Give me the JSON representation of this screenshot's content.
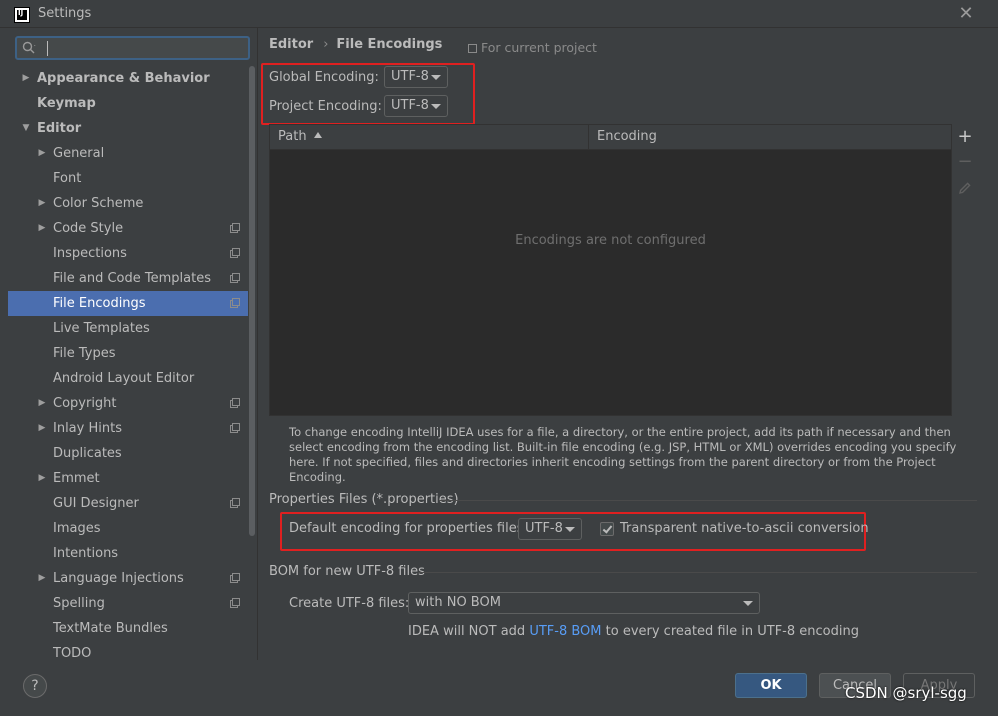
{
  "window": {
    "title": "Settings"
  },
  "search": {
    "value": "",
    "placeholder": ""
  },
  "sidebar": {
    "items": [
      {
        "label": "Appearance & Behavior",
        "level": 0,
        "arrow": "right",
        "bold": true,
        "copy": false,
        "selected": false
      },
      {
        "label": "Keymap",
        "level": 0,
        "arrow": "",
        "bold": true,
        "copy": false,
        "selected": false
      },
      {
        "label": "Editor",
        "level": 0,
        "arrow": "down",
        "bold": true,
        "copy": false,
        "selected": false
      },
      {
        "label": "General",
        "level": 1,
        "arrow": "right",
        "bold": false,
        "copy": false,
        "selected": false
      },
      {
        "label": "Font",
        "level": 1,
        "arrow": "",
        "bold": false,
        "copy": false,
        "selected": false
      },
      {
        "label": "Color Scheme",
        "level": 1,
        "arrow": "right",
        "bold": false,
        "copy": false,
        "selected": false
      },
      {
        "label": "Code Style",
        "level": 1,
        "arrow": "right",
        "bold": false,
        "copy": true,
        "selected": false
      },
      {
        "label": "Inspections",
        "level": 1,
        "arrow": "",
        "bold": false,
        "copy": true,
        "selected": false
      },
      {
        "label": "File and Code Templates",
        "level": 1,
        "arrow": "",
        "bold": false,
        "copy": true,
        "selected": false
      },
      {
        "label": "File Encodings",
        "level": 1,
        "arrow": "",
        "bold": false,
        "copy": true,
        "selected": true
      },
      {
        "label": "Live Templates",
        "level": 1,
        "arrow": "",
        "bold": false,
        "copy": false,
        "selected": false
      },
      {
        "label": "File Types",
        "level": 1,
        "arrow": "",
        "bold": false,
        "copy": false,
        "selected": false
      },
      {
        "label": "Android Layout Editor",
        "level": 1,
        "arrow": "",
        "bold": false,
        "copy": false,
        "selected": false
      },
      {
        "label": "Copyright",
        "level": 1,
        "arrow": "right",
        "bold": false,
        "copy": true,
        "selected": false
      },
      {
        "label": "Inlay Hints",
        "level": 1,
        "arrow": "right",
        "bold": false,
        "copy": true,
        "selected": false
      },
      {
        "label": "Duplicates",
        "level": 1,
        "arrow": "",
        "bold": false,
        "copy": false,
        "selected": false
      },
      {
        "label": "Emmet",
        "level": 1,
        "arrow": "right",
        "bold": false,
        "copy": false,
        "selected": false
      },
      {
        "label": "GUI Designer",
        "level": 1,
        "arrow": "",
        "bold": false,
        "copy": true,
        "selected": false
      },
      {
        "label": "Images",
        "level": 1,
        "arrow": "",
        "bold": false,
        "copy": false,
        "selected": false
      },
      {
        "label": "Intentions",
        "level": 1,
        "arrow": "",
        "bold": false,
        "copy": false,
        "selected": false
      },
      {
        "label": "Language Injections",
        "level": 1,
        "arrow": "right",
        "bold": false,
        "copy": true,
        "selected": false
      },
      {
        "label": "Spelling",
        "level": 1,
        "arrow": "",
        "bold": false,
        "copy": true,
        "selected": false
      },
      {
        "label": "TextMate Bundles",
        "level": 1,
        "arrow": "",
        "bold": false,
        "copy": false,
        "selected": false
      },
      {
        "label": "TODO",
        "level": 1,
        "arrow": "",
        "bold": false,
        "copy": false,
        "selected": false
      }
    ]
  },
  "breadcrumb": {
    "parent": "Editor",
    "current": "File Encodings"
  },
  "scope_note": "For current project",
  "global_encoding": {
    "label": "Global Encoding:",
    "value": "UTF-8"
  },
  "project_encoding": {
    "label": "Project Encoding:",
    "value": "UTF-8"
  },
  "table": {
    "columns": [
      "Path",
      "Encoding"
    ],
    "empty_text": "Encodings are not configured",
    "tools": {
      "add": "+",
      "remove": "−"
    }
  },
  "help_text": "To change encoding IntelliJ IDEA uses for a file, a directory, or the entire project, add its path if necessary and then select encoding from the encoding list. Built-in file encoding (e.g. JSP, HTML or XML) overrides encoding you specify here. If not specified, files and directories inherit encoding settings from the parent directory or from the Project Encoding.",
  "properties": {
    "section_title": "Properties Files (*.properties)",
    "default_label": "Default encoding for properties files:",
    "default_value": "UTF-8",
    "transparent_label": "Transparent native-to-ascii conversion",
    "transparent_checked": true
  },
  "bom": {
    "section_title": "BOM for new UTF-8 files",
    "create_label": "Create UTF-8 files:",
    "create_value": "with NO BOM",
    "note_prefix": "IDEA will NOT add ",
    "note_link": "UTF-8 BOM",
    "note_suffix": " to every created file in UTF-8 encoding"
  },
  "buttons": {
    "help": "?",
    "ok": "OK",
    "cancel": "Cancel",
    "apply": "Apply"
  },
  "watermark": "CSDN @sryl-sgg",
  "colors": {
    "background": "#3c3f41",
    "selection": "#4b6eaf",
    "highlight": "#e02020",
    "link": "#589df6",
    "ok_button": "#365880"
  }
}
